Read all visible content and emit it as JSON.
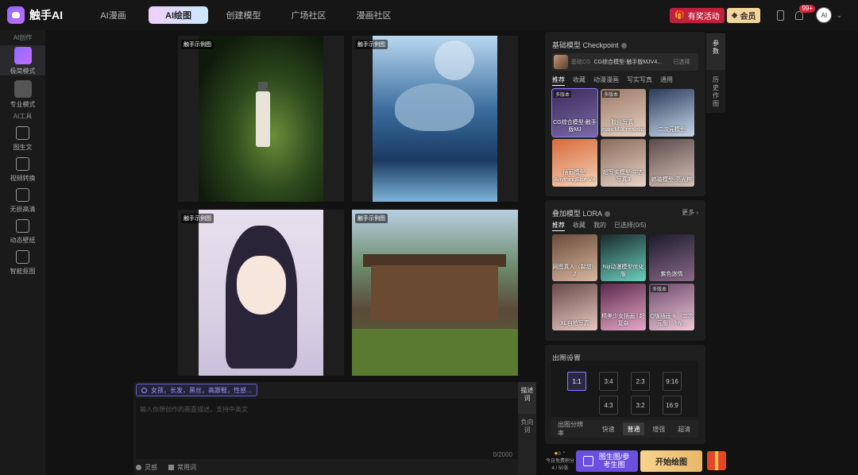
{
  "app": {
    "name": "触手AI"
  },
  "nav": {
    "items": [
      "AI漫画",
      "AI绘图",
      "创建模型",
      "广场社区",
      "漫画社区"
    ],
    "active": "AI绘图"
  },
  "header": {
    "event_label": "有奖活动",
    "member_label": "会员",
    "notification_count": "99+",
    "avatar_text": "AI"
  },
  "sidebar": {
    "section1": "AI创作",
    "section2": "AI工具",
    "items": [
      {
        "label": "极简模式",
        "icon": "sparkle-icon"
      },
      {
        "label": "专业模式",
        "icon": "pro-mode-icon"
      }
    ],
    "tools": [
      {
        "label": "图生文",
        "icon": "image-to-text-icon"
      },
      {
        "label": "视频转换",
        "icon": "video-convert-icon"
      },
      {
        "label": "无损高清",
        "icon": "hd-icon"
      },
      {
        "label": "动态壁纸",
        "icon": "live-wallpaper-icon"
      },
      {
        "label": "智能抠图",
        "icon": "cutout-icon"
      }
    ]
  },
  "gallery": {
    "tag": "触手示例图"
  },
  "prompt": {
    "chip": "女孩，长发，黑丝，高跟鞋，性感...",
    "placeholder": "输入你想创作的画面描述，支持中英文",
    "counter": "0/2000",
    "tab_desc": "描述词",
    "tab_neg": "负向词",
    "inspiration": "灵感",
    "common_words": "常用词"
  },
  "base_model": {
    "title": "基础模型 Checkpoint",
    "selected_sub": "基础CG",
    "selected_name": "CG综合模型-触手版MJV4...",
    "selected_used": "已选择",
    "tabs": [
      "推荐",
      "收藏",
      "动漫漫画",
      "写实写真",
      "通用"
    ],
    "models": [
      {
        "label": "CG综合模型-触手版MJ",
        "tag": "多版本",
        "colors": [
          "#3a2a5a",
          "#7a6aa8"
        ]
      },
      {
        "label": "胶片写真-majicMIX realistic",
        "tag": "多版本",
        "colors": [
          "#9a7a6a",
          "#e8d0c0"
        ]
      },
      {
        "label": "二次元模型",
        "tag": "",
        "colors": [
          "#2a3a5a",
          "#c8d8ea"
        ]
      },
      {
        "label": "插画模型-AnythingElse V4",
        "tag": "",
        "colors": [
          "#d86a3a",
          "#f4d2b8"
        ]
      },
      {
        "label": "超写实模型-中古写真3",
        "tag": "",
        "colors": [
          "#8a6a5a",
          "#e8d4c8"
        ]
      },
      {
        "label": "韩璇模型-亮光粹",
        "tag": "",
        "colors": [
          "#5a4a4a",
          "#d8c2b8"
        ]
      }
    ]
  },
  "lora": {
    "title": "叠加模型 LORA",
    "more": "更多",
    "tabs": [
      "推荐",
      "收藏",
      "我的",
      "已选择(0/5)"
    ],
    "items": [
      {
        "label": "网图真人（裂甜）2",
        "tag": "",
        "colors": [
          "#6a4a3a",
          "#d8b8a0"
        ]
      },
      {
        "label": "Niji动漫模型优化版",
        "tag": "",
        "colors": [
          "#1a2a2a",
          "#6ad0c0"
        ]
      },
      {
        "label": "紫色迷情",
        "tag": "",
        "colors": [
          "#1a1a2a",
          "#8a6a8a"
        ]
      },
      {
        "label": "XL自拍写真",
        "tag": "",
        "colors": [
          "#6a4a4a",
          "#e8c8c0"
        ]
      },
      {
        "label": "精美少女插画 | 超复杂",
        "tag": "",
        "colors": [
          "#5a2a4a",
          "#e8a8c8"
        ]
      },
      {
        "label": "Q版插画卡（二次元版）/Hy...",
        "tag": "多版本",
        "colors": [
          "#6a4a6a",
          "#f0c8d8"
        ]
      }
    ]
  },
  "output": {
    "title": "出图设置",
    "ratios": [
      "1:1",
      "3:4",
      "2:3",
      "9:16",
      "4:3",
      "3:2",
      "16:9"
    ],
    "active_ratio": "1:1",
    "res_label": "出图分辨率",
    "res_options": [
      "快速",
      "普通",
      "增强",
      "超清"
    ],
    "active_res": "普通"
  },
  "actions": {
    "cost": "0",
    "cost_sub": "今日免费积分",
    "cost_count": "4 / 50张",
    "reference": "图生图/参考生图",
    "start": "开始绘图"
  },
  "right_tabs": [
    "参数",
    "历史作图"
  ],
  "colors": {
    "accent": "#8a7cff",
    "gold": "#f2d59a",
    "event": "#c0203a"
  }
}
